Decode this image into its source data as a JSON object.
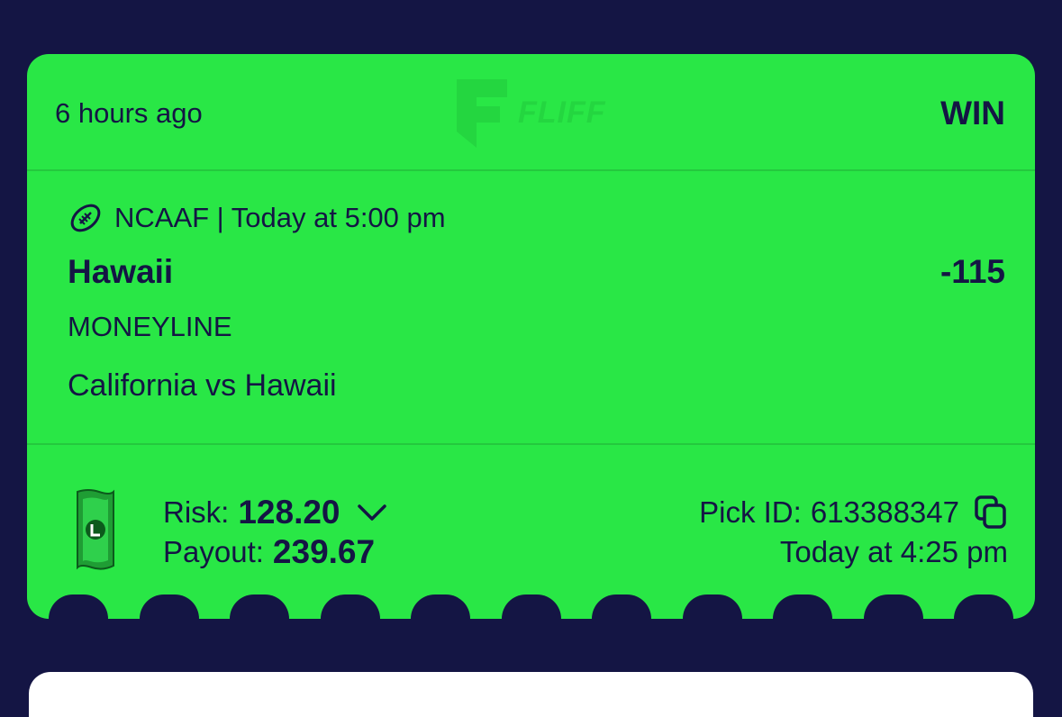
{
  "ticket": {
    "time_ago": "6 hours ago",
    "logo_text": "FLIFF",
    "status": "WIN",
    "event": {
      "sport_icon": "football-icon",
      "league": "NCAAF",
      "separator": "|",
      "start_time": "Today at 5:00 pm",
      "line": "NCAAF | Today at 5:00 pm"
    },
    "selection": "Hawaii",
    "odds": "-115",
    "market": "MONEYLINE",
    "matchup": "California vs Hawaii",
    "risk_label": "Risk:",
    "risk_value": "128.20",
    "payout_label": "Payout:",
    "payout_value": "239.67",
    "pick_id_label": "Pick ID:",
    "pick_id_value": "613388347",
    "placed_at": "Today at 4:25 pm",
    "currency_icon": "cash-icon",
    "expand_icon": "chevron-down-icon",
    "copy_icon": "copy-icon"
  },
  "colors": {
    "background": "#141544",
    "card": "#29e746",
    "text": "#141544",
    "divider": "#24c93e"
  }
}
